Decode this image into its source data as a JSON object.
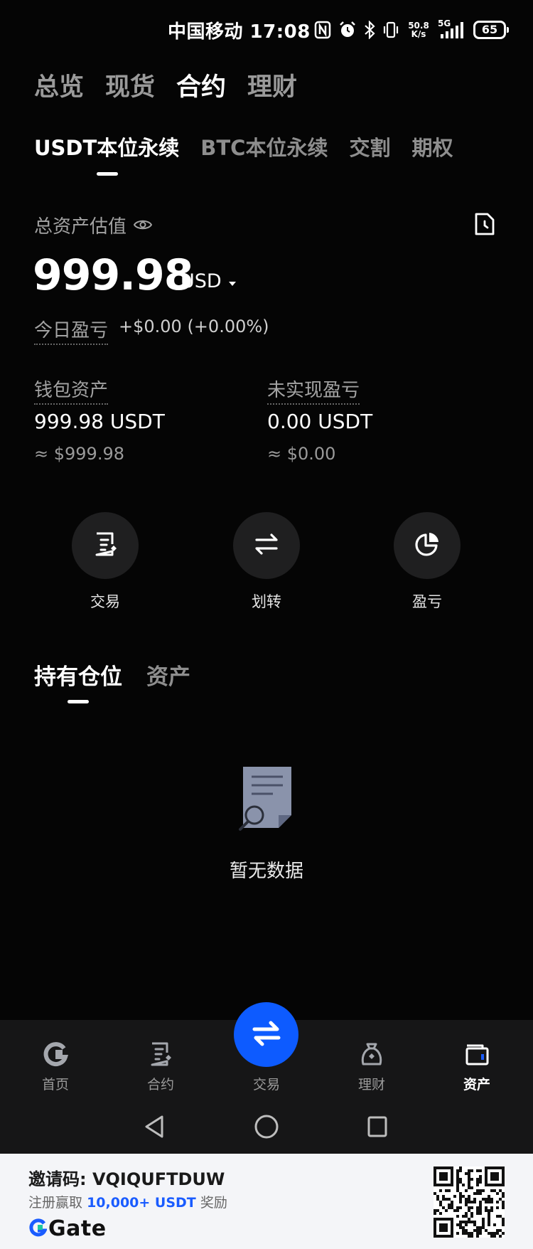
{
  "status_bar": {
    "carrier_time": "中国移动 17:08",
    "net_speed_top": "50.8",
    "net_speed_bottom": "K/s",
    "network": "5G",
    "battery": "65",
    "icons": [
      "nfc-icon",
      "alarm-icon",
      "bluetooth-icon",
      "vibrate-icon",
      "signal-icon",
      "battery-icon"
    ]
  },
  "top_tabs": [
    {
      "label": "总览",
      "active": false
    },
    {
      "label": "现货",
      "active": false
    },
    {
      "label": "合约",
      "active": true
    },
    {
      "label": "理财",
      "active": false
    }
  ],
  "sub_tabs": [
    {
      "label": "USDT本位永续",
      "active": true
    },
    {
      "label": "BTC本位永续",
      "active": false
    },
    {
      "label": "交割",
      "active": false
    },
    {
      "label": "期权",
      "active": false
    }
  ],
  "summary": {
    "total_label": "总资产估值",
    "total_value": "999.98",
    "currency": "USD",
    "pnl_label": "今日盈亏",
    "pnl_value": "+$0.00 (+0.00%)"
  },
  "balances": {
    "wallet": {
      "label": "钱包资产",
      "value": "999.98 USDT",
      "approx": "≈ $999.98"
    },
    "unrealized": {
      "label": "未实现盈亏",
      "value": "0.00 USDT",
      "approx": "≈ $0.00"
    }
  },
  "actions": {
    "trade": "交易",
    "transfer": "划转",
    "pnl": "盈亏"
  },
  "position_tabs": [
    {
      "label": "持有仓位",
      "active": true
    },
    {
      "label": "资产",
      "active": false
    }
  ],
  "empty_state": {
    "text": "暂无数据"
  },
  "bottom_nav": {
    "home": "首页",
    "contract": "合约",
    "trade": "交易",
    "finance": "理财",
    "assets": "资产",
    "active": "assets"
  },
  "invite": {
    "code_label": "邀请码: VQIQUFTDUW",
    "reward_prefix": "注册赢取",
    "reward_amount": "10,000+ USDT",
    "reward_suffix": "奖励",
    "brand": "Gate"
  },
  "colors": {
    "background": "#050505",
    "accent_blue": "#0d5bff",
    "muted_text": "#a3a3a3",
    "footer_bg": "#f4f5f8"
  }
}
